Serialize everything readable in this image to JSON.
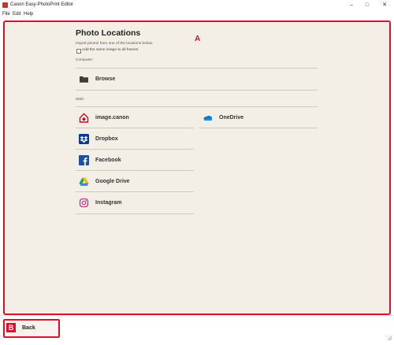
{
  "window": {
    "title": "Canon Easy-PhotoPrint Editor",
    "minimize": "–",
    "maximize": "□",
    "close": "✕"
  },
  "menu": [
    "File",
    "Edit",
    "Help"
  ],
  "callouts": {
    "a": "A",
    "b": "B"
  },
  "page": {
    "heading": "Photo Locations",
    "subtext": "Import photos from one of the locations below.",
    "checkbox_label": "Add the same image to all frames",
    "checkbox_checked": false
  },
  "computer": {
    "label": "Computer:",
    "items": [
      {
        "label": "Browse",
        "icon": "folder-icon"
      }
    ]
  },
  "web": {
    "label": "Web:",
    "items": [
      {
        "label": "image.canon",
        "icon": "image-canon-icon"
      },
      {
        "label": "OneDrive",
        "icon": "onedrive-icon"
      },
      {
        "label": "Dropbox",
        "icon": "dropbox-icon"
      },
      {
        "label": "Facebook",
        "icon": "facebook-icon"
      },
      {
        "label": "Google Drive",
        "icon": "google-drive-icon"
      },
      {
        "label": "Instagram",
        "icon": "instagram-icon"
      }
    ]
  },
  "footer": {
    "back_label": "Back"
  },
  "colors": {
    "accent_red": "#e0102a",
    "panel_bg": "#f4efe6",
    "dropbox": "#0061fe",
    "facebook": "#1877f2",
    "onedrive": "#0364b8"
  }
}
